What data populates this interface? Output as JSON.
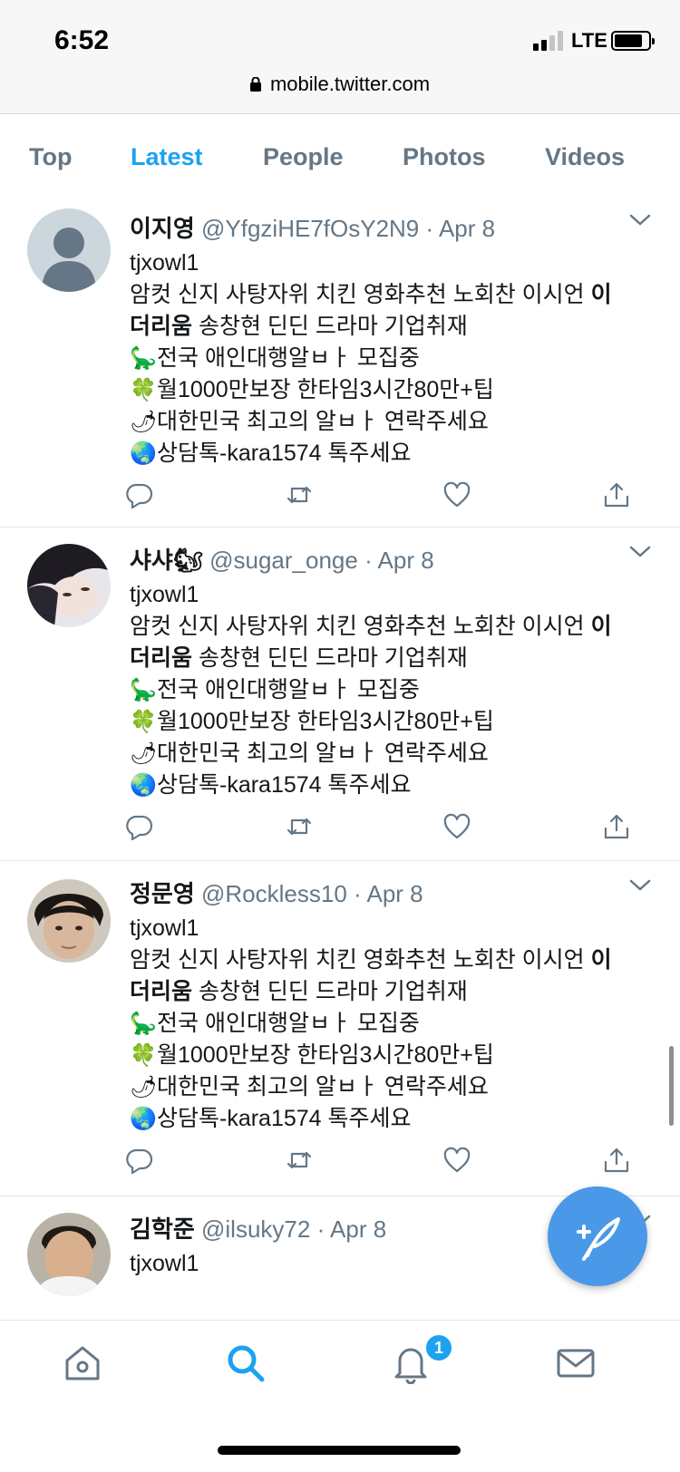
{
  "status": {
    "time": "6:52",
    "network": "LTE"
  },
  "browser": {
    "url": "mobile.twitter.com"
  },
  "tabs": [
    {
      "label": "Top"
    },
    {
      "label": "Latest"
    },
    {
      "label": "People"
    },
    {
      "label": "Photos"
    },
    {
      "label": "Videos"
    }
  ],
  "active_tab": "Latest",
  "tweets": [
    {
      "name": "이지영",
      "handle": "@YfgziHE7fOsY2N9",
      "dot": "·",
      "date": "Apr 8",
      "lines": [
        "tjxowl1",
        "암컷 신지 사탕자위 치킨 영화추천 노회찬 이시언",
        "이",
        "더리움",
        "송창현 딘딘 드라마 기업취재",
        "전국 애인대행알ㅂㅏ 모집중",
        "월1000만보장 한타임3시간80만+팁",
        "대한민국 최고의 알ㅂㅏ 연락주세요",
        "상담톡-kara1574 톡주세요"
      ]
    },
    {
      "name": "샤샤🐿",
      "handle": "@sugar_onge",
      "dot": "·",
      "date": "Apr 8",
      "lines": [
        "tjxowl1",
        "암컷 신지 사탕자위 치킨 영화추천 노회찬 이시언",
        "이",
        "더리움",
        "송창현 딘딘 드라마 기업취재",
        "전국 애인대행알ㅂㅏ 모집중",
        "월1000만보장 한타임3시간80만+팁",
        "대한민국 최고의 알ㅂㅏ 연락주세요",
        "상담톡-kara1574 톡주세요"
      ]
    },
    {
      "name": "정문영",
      "handle": "@Rockless10",
      "dot": "·",
      "date": "Apr 8",
      "lines": [
        "tjxowl1",
        "암컷 신지 사탕자위 치킨 영화추천 노회찬 이시언",
        "이",
        "더리움",
        "송창현 딘딘 드라마 기업취재",
        "전국 애인대행알ㅂㅏ 모집중",
        "월1000만보장 한타임3시간80만+팁",
        "대한민국 최고의 알ㅂㅏ 연락주세요",
        "상담톡-kara1574 톡주세요"
      ]
    },
    {
      "name": "김학준",
      "handle": "@ilsuky72",
      "dot": "·",
      "date": "Apr 8",
      "lines": [
        "tjxowl1"
      ]
    }
  ],
  "emoji": {
    "dino": "🦕",
    "clover": "🍀",
    "pepper": "🌶",
    "globe": "🌏"
  },
  "nav": {
    "notification_count": "1"
  },
  "colors": {
    "accent": "#1da1f2",
    "muted": "#657786",
    "fab": "#4a99e9"
  }
}
